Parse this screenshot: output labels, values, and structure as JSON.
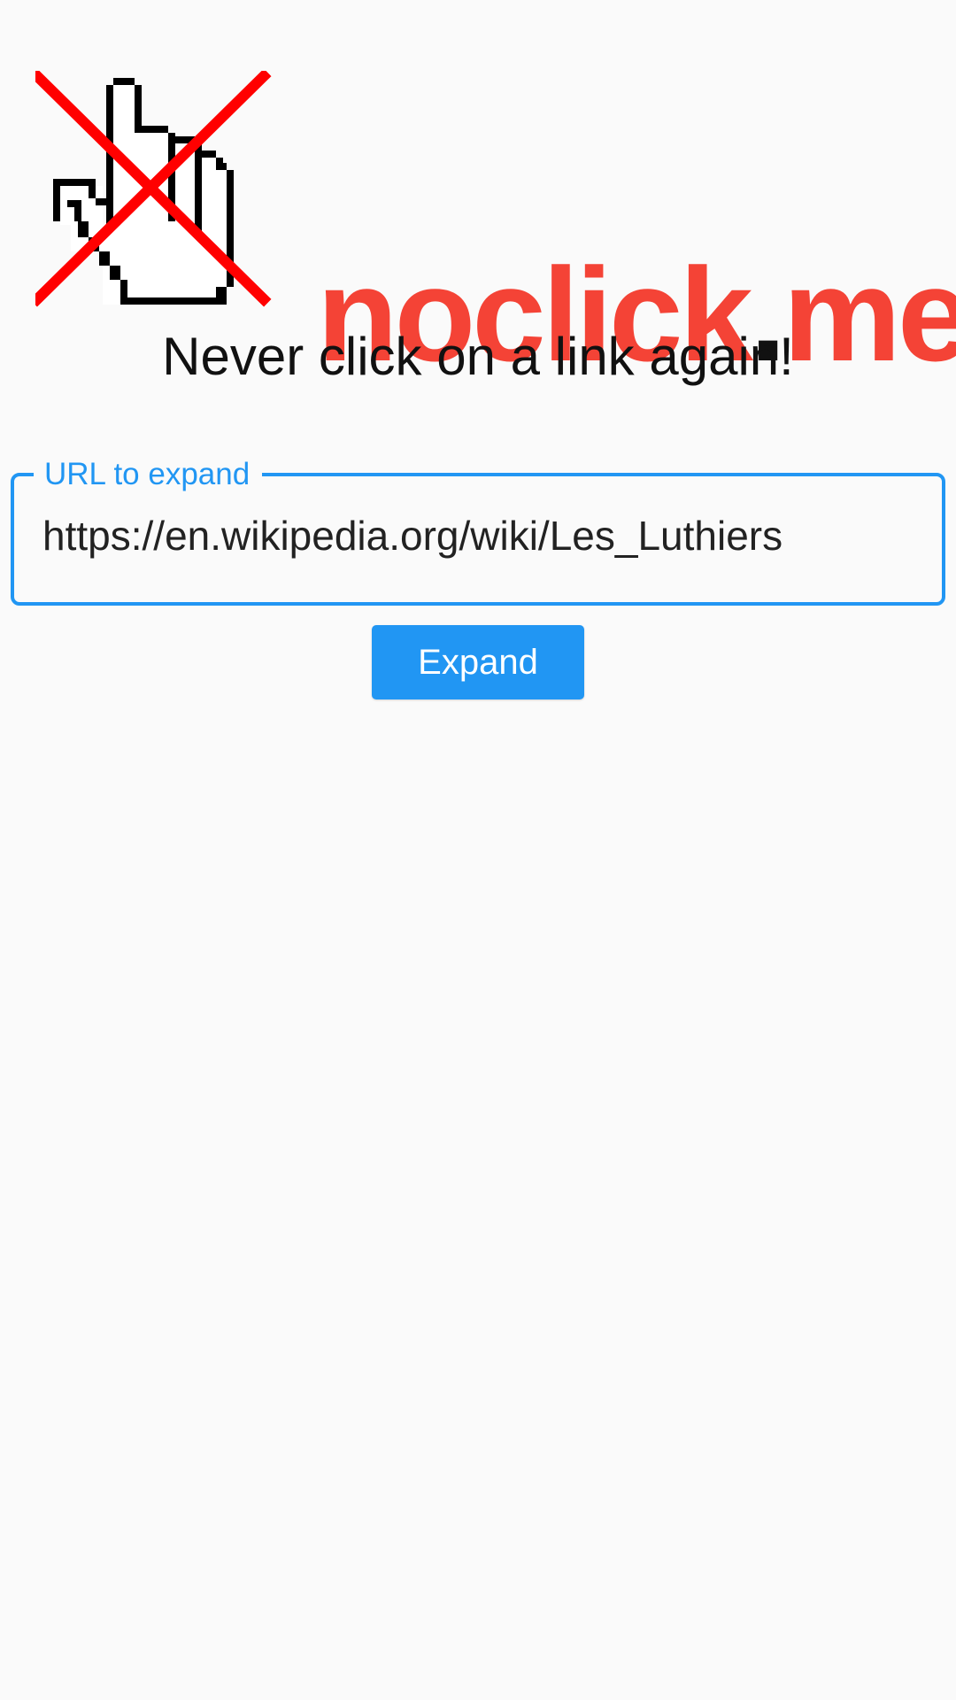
{
  "logo": {
    "icon": "crossed-out-pointing-hand-icon",
    "brand_main": "noclick",
    "brand_dot": ".",
    "brand_tld": "me",
    "brand_color": "#f44336",
    "cross_color": "#ff0000"
  },
  "tagline": "Never click on a link again!",
  "url_field": {
    "label": "URL to expand",
    "value": "https://en.wikipedia.org/wiki/Les_Luthiers",
    "accent_color": "#2196f3"
  },
  "expand_button": {
    "label": "Expand",
    "color": "#2196f3"
  }
}
